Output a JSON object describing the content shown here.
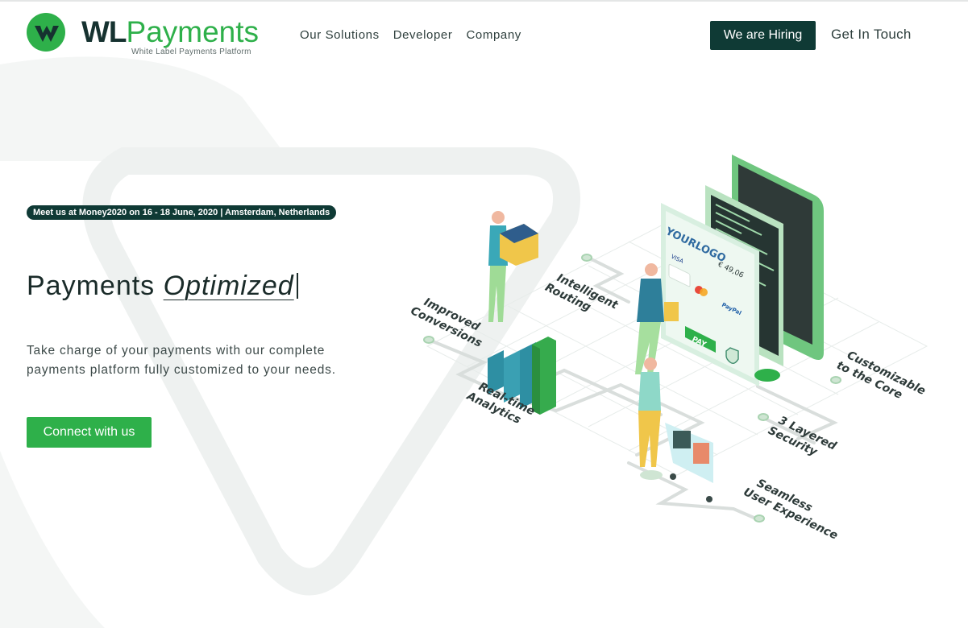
{
  "brand": {
    "name_primary": "WL",
    "name_secondary": "Payments",
    "tagline": "White Label Payments Platform",
    "colors": {
      "green": "#2eb04a",
      "dark": "#0f3a35"
    }
  },
  "nav": {
    "items": [
      {
        "label": "Our Solutions"
      },
      {
        "label": "Developer"
      },
      {
        "label": "Company"
      }
    ],
    "hiring_label": "We are Hiring",
    "contact_label": "Get In Touch"
  },
  "hero": {
    "event_badge": "Meet us at Money2020 on 16 - 18 June, 2020 | Amsterdam, Netherlands",
    "title_prefix": "Payments ",
    "title_emphasis": "Optimized",
    "description": "Take charge of your payments with our complete payments platform fully customized to your needs.",
    "cta_label": "Connect with us"
  },
  "illustration": {
    "screen": {
      "logo_text": "YOURLOGO",
      "amount": "€ 49,06",
      "card_visa": "VISA",
      "card_paypal": "PayPal",
      "pay_label": "PAY"
    },
    "features": [
      {
        "line1": "Improved",
        "line2": "Conversions"
      },
      {
        "line1": "Intelligent",
        "line2": "Routing"
      },
      {
        "line1": "Real-time",
        "line2": "Analytics"
      },
      {
        "line1": "Customizable",
        "line2": "to the Core"
      },
      {
        "line1": "3 Layered",
        "line2": "Security"
      },
      {
        "line1": "Seamless",
        "line2": "User Experience"
      }
    ]
  }
}
